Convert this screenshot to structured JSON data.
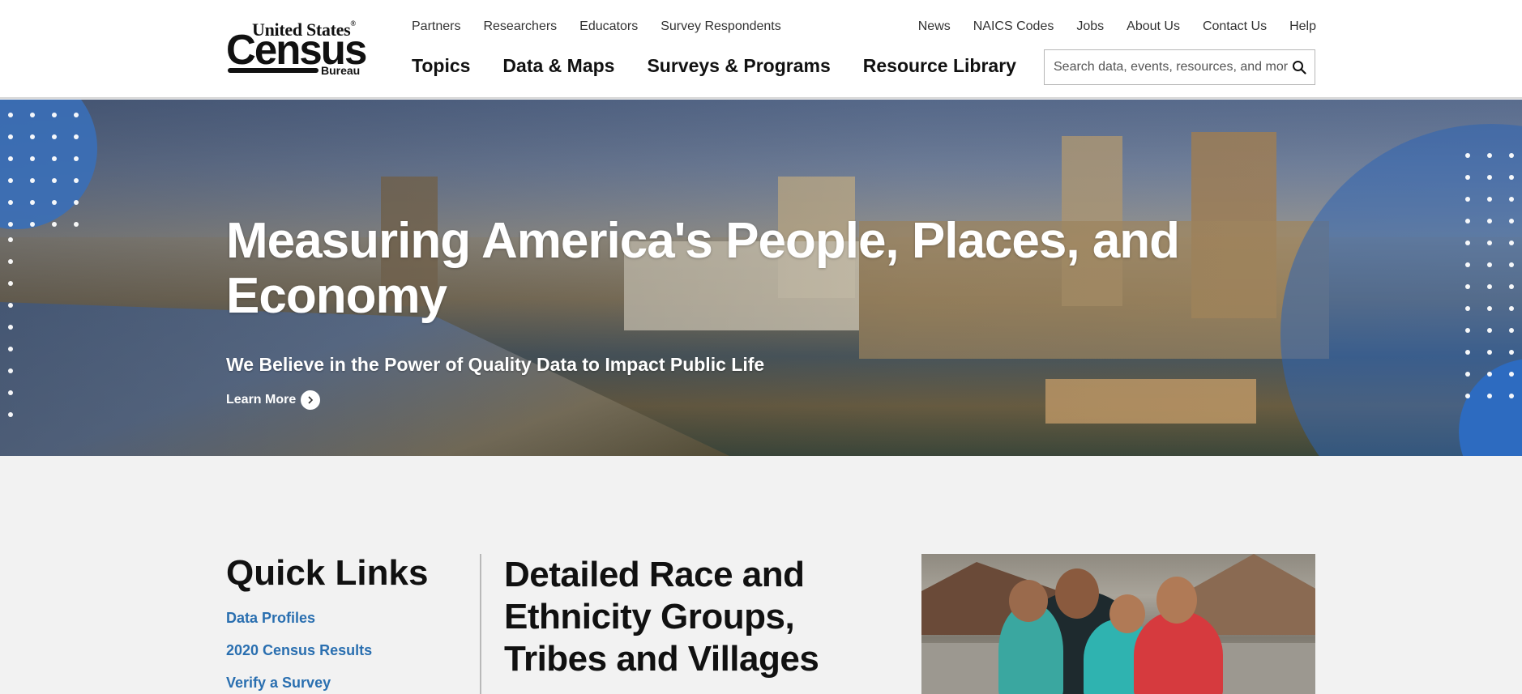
{
  "logo": {
    "line1": "United States",
    "reg": "®",
    "line2": "Census",
    "line3": "Bureau"
  },
  "utility_left": [
    "Partners",
    "Researchers",
    "Educators",
    "Survey Respondents"
  ],
  "utility_right": [
    "News",
    "NAICS Codes",
    "Jobs",
    "About Us",
    "Contact Us",
    "Help"
  ],
  "main_nav": [
    "Topics",
    "Data & Maps",
    "Surveys & Programs",
    "Resource Library"
  ],
  "search": {
    "placeholder": "Search data, events, resources, and more"
  },
  "hero": {
    "title": "Measuring America's People, Places, and Economy",
    "subtitle": "We Believe in the Power of Quality Data to Impact Public Life",
    "cta": "Learn More"
  },
  "quick_links": {
    "title": "Quick Links",
    "items": [
      "Data Profiles",
      "2020 Census Results",
      "Verify a Survey"
    ]
  },
  "feature": {
    "title": "Detailed Race and Ethnicity Groups, Tribes and Villages"
  },
  "colors": {
    "link": "#2a6fb0",
    "accent_blue": "#2d6bc0"
  }
}
